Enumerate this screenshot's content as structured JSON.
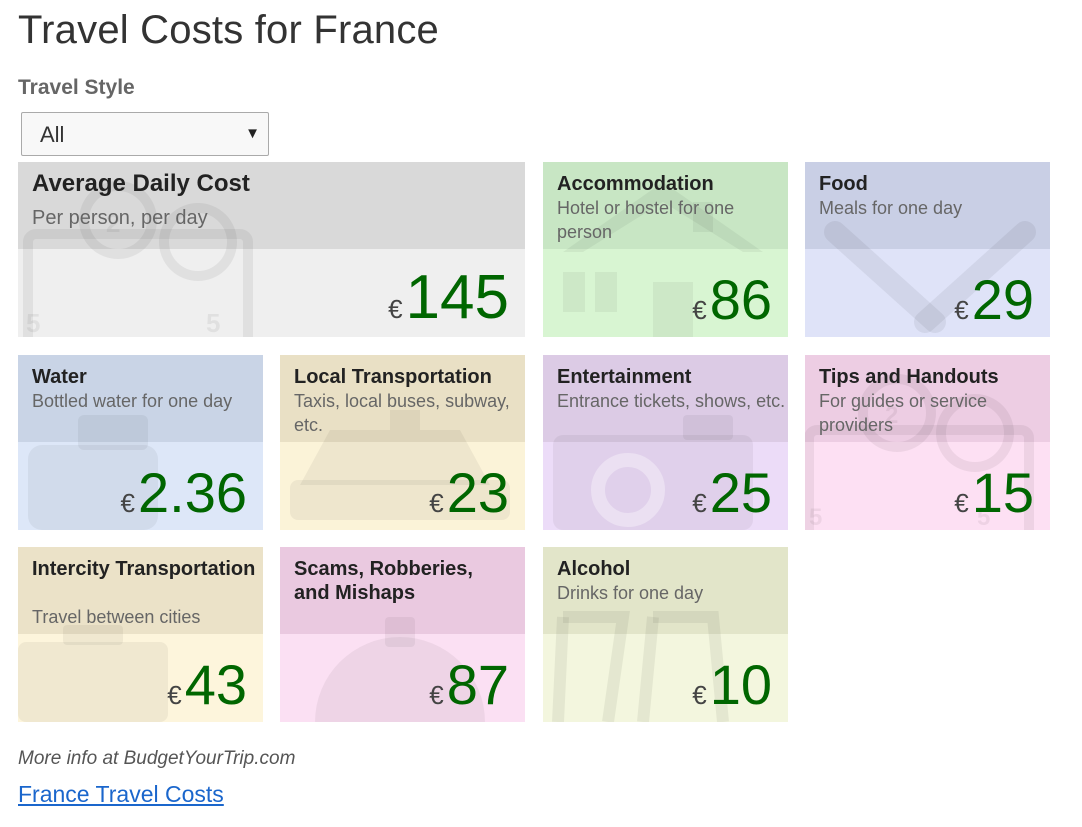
{
  "page": {
    "title": "Travel Costs for France"
  },
  "travel_style": {
    "label": "Travel Style",
    "selected": "All"
  },
  "cards": {
    "average": {
      "name": "Average Daily Cost",
      "desc": "Per person, per day",
      "currency": "€",
      "amount": "145",
      "head_color": "#d9d9d9",
      "body_color": "#efefef"
    },
    "accommodation": {
      "name": "Accommodation",
      "desc": "Hotel or hostel for one person",
      "currency": "€",
      "amount": "86",
      "head_color": "#c8e6c4",
      "body_color": "#d8f5d2"
    },
    "food": {
      "name": "Food",
      "desc": "Meals for one day",
      "currency": "€",
      "amount": "29",
      "head_color": "#c9cfe5",
      "body_color": "#dfe3f8"
    },
    "water": {
      "name": "Water",
      "desc": "Bottled water for one day",
      "currency": "€",
      "amount": "2.36",
      "head_color": "#c9d4e6",
      "body_color": "#dde7f8"
    },
    "local_transport": {
      "name": "Local Transportation",
      "desc": "Taxis, local buses, subway, etc.",
      "currency": "€",
      "amount": "23",
      "head_color": "#e9e0c5",
      "body_color": "#fbf3d8"
    },
    "entertainment": {
      "name": "Entertainment",
      "desc": "Entrance tickets, shows, etc.",
      "currency": "€",
      "amount": "25",
      "head_color": "#dccbe5",
      "body_color": "#ecdcf8"
    },
    "tips": {
      "name": "Tips and Handouts",
      "desc": "For guides or service providers",
      "currency": "€",
      "amount": "15",
      "head_color": "#edcde3",
      "body_color": "#fde0f3"
    },
    "intercity": {
      "name": "Intercity Transportation",
      "desc": "Travel between cities",
      "currency": "€",
      "amount": "43",
      "head_color": "#ebe2c8",
      "body_color": "#fdf5dc"
    },
    "scams": {
      "name": "Scams, Robberies, and Mishaps",
      "desc": "",
      "currency": "€",
      "amount": "87",
      "head_color": "#eac9e0",
      "body_color": "#fbe0f3"
    },
    "alcohol": {
      "name": "Alcohol",
      "desc": "Drinks for one day",
      "currency": "€",
      "amount": "10",
      "head_color": "#e2e5c9",
      "body_color": "#f3f6de"
    }
  },
  "footer": {
    "more_info": "More info at BudgetYourTrip.com",
    "link_text": "France Travel Costs"
  },
  "icons": {
    "average": "calendar-icon",
    "accommodation": "house-icon",
    "food": "utensils-icon",
    "water": "water-jug-icon",
    "local_transport": "taxi-icon",
    "entertainment": "camera-icon",
    "tips": "calendar-icon",
    "intercity": "suitcase-icon",
    "scams": "bomb-icon",
    "alcohol": "wine-glasses-icon"
  }
}
